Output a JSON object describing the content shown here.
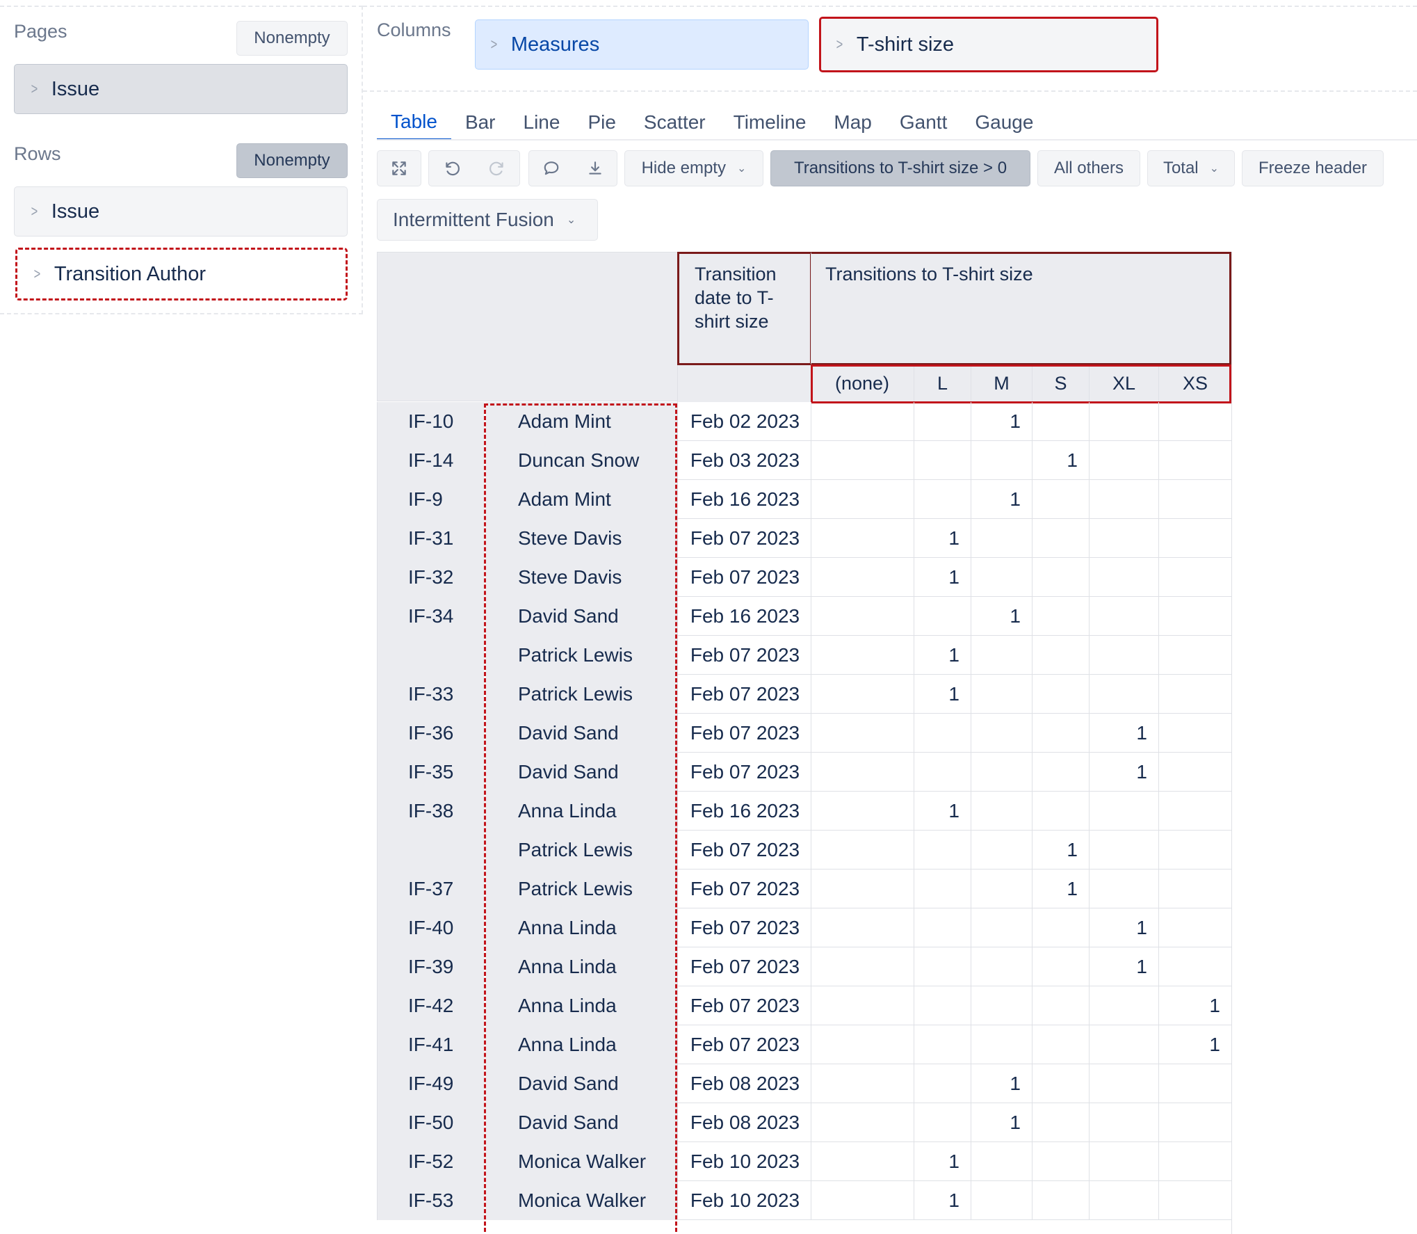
{
  "pages": {
    "label": "Pages",
    "nonempty_label": "Nonempty",
    "chips": [
      "Issue"
    ]
  },
  "rows_panel": {
    "label": "Rows",
    "nonempty_label": "Nonempty",
    "chips": [
      "Issue",
      "Transition Author"
    ]
  },
  "columns": {
    "label": "Columns",
    "chips": [
      "Measures",
      "T-shirt size"
    ]
  },
  "tabs": [
    "Table",
    "Bar",
    "Line",
    "Pie",
    "Scatter",
    "Timeline",
    "Map",
    "Gantt",
    "Gauge"
  ],
  "toolbar": {
    "hide_empty": "Hide empty",
    "filter": "Transitions to T-shirt size > 0",
    "all_others": "All others",
    "total": "Total",
    "freeze_header": "Freeze header",
    "icons": [
      "expand-icon",
      "undo-icon",
      "redo-icon",
      "comment-icon",
      "download-icon"
    ]
  },
  "project_dropdown": "Intermittent Fusion",
  "table": {
    "header_date": "Transition date to T-shirt size",
    "header_measure": "Transitions to T-shirt size",
    "sizes": [
      "(none)",
      "L",
      "M",
      "S",
      "XL",
      "XS"
    ],
    "rows": [
      {
        "issue": "IF-10",
        "author": "Adam Mint",
        "date": "Feb 02 2023",
        "size": "M",
        "value": "1"
      },
      {
        "issue": "IF-14",
        "author": "Duncan Snow",
        "date": "Feb 03 2023",
        "size": "S",
        "value": "1"
      },
      {
        "issue": "IF-9",
        "author": "Adam Mint",
        "date": "Feb 16 2023",
        "size": "M",
        "value": "1"
      },
      {
        "issue": "IF-31",
        "author": "Steve Davis",
        "date": "Feb 07 2023",
        "size": "L",
        "value": "1"
      },
      {
        "issue": "IF-32",
        "author": "Steve Davis",
        "date": "Feb 07 2023",
        "size": "L",
        "value": "1"
      },
      {
        "issue": "IF-34",
        "author": "David Sand",
        "date": "Feb 16 2023",
        "size": "M",
        "value": "1"
      },
      {
        "issue": "",
        "author": "Patrick Lewis",
        "date": "Feb 07 2023",
        "size": "L",
        "value": "1"
      },
      {
        "issue": "IF-33",
        "author": "Patrick Lewis",
        "date": "Feb 07 2023",
        "size": "L",
        "value": "1"
      },
      {
        "issue": "IF-36",
        "author": "David Sand",
        "date": "Feb 07 2023",
        "size": "XL",
        "value": "1"
      },
      {
        "issue": "IF-35",
        "author": "David Sand",
        "date": "Feb 07 2023",
        "size": "XL",
        "value": "1"
      },
      {
        "issue": "IF-38",
        "author": "Anna Linda",
        "date": "Feb 16 2023",
        "size": "L",
        "value": "1"
      },
      {
        "issue": "",
        "author": "Patrick Lewis",
        "date": "Feb 07 2023",
        "size": "S",
        "value": "1"
      },
      {
        "issue": "IF-37",
        "author": "Patrick Lewis",
        "date": "Feb 07 2023",
        "size": "S",
        "value": "1"
      },
      {
        "issue": "IF-40",
        "author": "Anna Linda",
        "date": "Feb 07 2023",
        "size": "XL",
        "value": "1"
      },
      {
        "issue": "IF-39",
        "author": "Anna Linda",
        "date": "Feb 07 2023",
        "size": "XL",
        "value": "1"
      },
      {
        "issue": "IF-42",
        "author": "Anna Linda",
        "date": "Feb 07 2023",
        "size": "XS",
        "value": "1"
      },
      {
        "issue": "IF-41",
        "author": "Anna Linda",
        "date": "Feb 07 2023",
        "size": "XS",
        "value": "1"
      },
      {
        "issue": "IF-49",
        "author": "David Sand",
        "date": "Feb 08 2023",
        "size": "M",
        "value": "1"
      },
      {
        "issue": "IF-50",
        "author": "David Sand",
        "date": "Feb 08 2023",
        "size": "M",
        "value": "1"
      },
      {
        "issue": "IF-52",
        "author": "Monica Walker",
        "date": "Feb 10 2023",
        "size": "L",
        "value": "1"
      },
      {
        "issue": "IF-53",
        "author": "Monica Walker",
        "date": "Feb 10 2023",
        "size": "L",
        "value": "1"
      }
    ]
  },
  "colors": {
    "accent": "#0052cc",
    "highlight_border": "#c2141b",
    "header_bg": "#ebecf0",
    "measures_chip_bg": "#deebff"
  }
}
